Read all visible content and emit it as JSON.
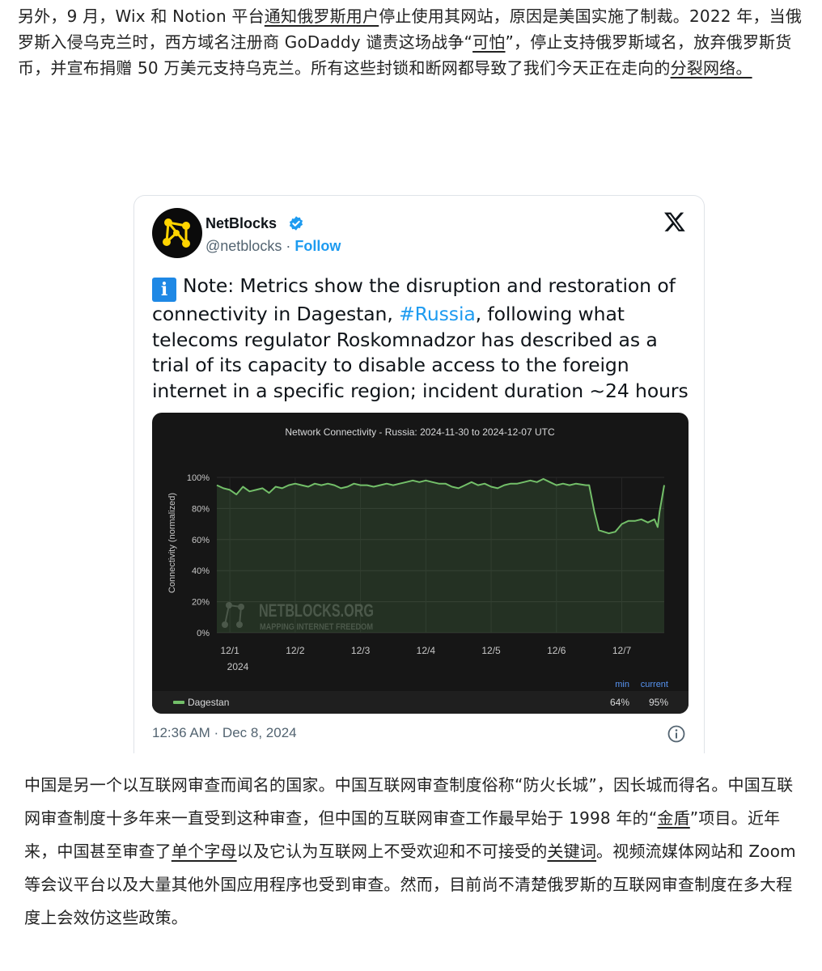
{
  "article": {
    "para1": {
      "t1": "另外，9 月，Wix 和 Notion 平台",
      "link1": "通知俄罗斯用户",
      "t2": "停止使用其网站，原因是美国实施了制裁。2022 年，当俄罗斯入侵乌克兰时，西方域名注册商 GoDaddy 谴责这场战争“",
      "link2": "可怕",
      "t3": "”，停止支持俄罗斯域名，放弃俄罗斯货币，并宣布捐赠 50 万美元支持乌克兰。所有这些封锁和断网都导致了我们今天正在走向的",
      "link3": "分裂网络。"
    },
    "para2": {
      "t1": "中国是另一个以互联网审查而闻名的国家。中国互联网审查制度俗称“防火长城”，因长城而得名。中国互联网审查制度十多年来一直受到这种审查，但中国的互联网审查工作最早始于 1998 年的“",
      "link1": "金盾",
      "t2": "”项目。近年来，中国甚至审查了",
      "link2": "单个字母",
      "t3": "以及它认为互联网上不受欢迎和不可接受的",
      "link3": "关键词",
      "t4": "。视频流媒体网站和 Zoom 等会议平台以及大量其他外国应用程序也受到审查。然而，目前尚不清楚俄罗斯的互联网审查制度在多大程度上会效仿这些政策。"
    }
  },
  "tweet": {
    "author": "NetBlocks",
    "handle": "@netblocks",
    "separator": "·",
    "follow": "Follow",
    "text_pre": "Note: Metrics show the disruption and restoration of connectivity in Dagestan, ",
    "hashtag": "#Russia",
    "text_post": ", following what telecoms regulator Roskomnadzor has described as a trial of its capacity to disable access to the foreign internet in a specific region; incident duration ~24 hours",
    "info_glyph": "i",
    "timestamp": "12:36 AM · Dec 8, 2024",
    "icons": {
      "avatar": "netblocks-logo",
      "verified": "verified-badge",
      "platform": "x-logo",
      "info": "info-circle"
    },
    "colors": {
      "link": "#1d9bf0",
      "name": "#0f1419",
      "muted": "#536471"
    }
  },
  "chart_data": {
    "type": "area",
    "title": "Network Connectivity - Russia: 2024-11-30 to 2024-12-07 UTC",
    "ylabel": "Connectivity (normalized)",
    "ylim": [
      0,
      100
    ],
    "y_ticks": [
      "100%",
      "80%",
      "60%",
      "40%",
      "20%",
      "0%"
    ],
    "x_ticks": [
      "12/1",
      "12/2",
      "12/3",
      "12/4",
      "12/5",
      "12/6",
      "12/7"
    ],
    "x_year": "2024",
    "xlim": [
      0.8,
      7.65
    ],
    "grid": true,
    "series": [
      {
        "name": "Dagestan",
        "color": "#73bf69",
        "x": [
          0.8,
          0.9,
          1.0,
          1.1,
          1.2,
          1.3,
          1.4,
          1.5,
          1.6,
          1.7,
          1.8,
          1.9,
          2.0,
          2.1,
          2.2,
          2.3,
          2.4,
          2.5,
          2.6,
          2.7,
          2.8,
          2.9,
          3.0,
          3.1,
          3.2,
          3.3,
          3.4,
          3.5,
          3.6,
          3.7,
          3.8,
          3.9,
          4.0,
          4.1,
          4.2,
          4.3,
          4.4,
          4.5,
          4.6,
          4.7,
          4.8,
          4.9,
          5.0,
          5.1,
          5.2,
          5.3,
          5.4,
          5.5,
          5.6,
          5.7,
          5.8,
          5.9,
          6.0,
          6.1,
          6.2,
          6.3,
          6.45,
          6.5,
          6.58,
          6.65,
          6.8,
          6.9,
          7.0,
          7.1,
          7.2,
          7.3,
          7.4,
          7.5,
          7.55,
          7.58,
          7.65
        ],
        "y": [
          95,
          93,
          92,
          89,
          94,
          91,
          92,
          93,
          90,
          94,
          93,
          95,
          96,
          95,
          94,
          96,
          95,
          96,
          95,
          93,
          94,
          96,
          95,
          95,
          94,
          95,
          96,
          95,
          96,
          97,
          98,
          97,
          98,
          97,
          96,
          96,
          94,
          93,
          95,
          97,
          95,
          96,
          94,
          93,
          95,
          96,
          96,
          97,
          98,
          97,
          99,
          97,
          95,
          96,
          95,
          96,
          95,
          95,
          78,
          66,
          64,
          65,
          70,
          72,
          72,
          73,
          71,
          73,
          68,
          78,
          95
        ]
      }
    ],
    "legend": {
      "position": "bottom",
      "headers": [
        "min",
        "current"
      ],
      "values": [
        "64%",
        "95%"
      ]
    },
    "watermark": {
      "brand": "NETBLOCKS.ORG",
      "tagline": "MAPPING INTERNET FREEDOM"
    }
  }
}
